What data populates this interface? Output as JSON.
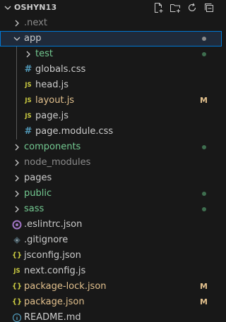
{
  "colors": {
    "background": "#181818",
    "text_default": "#cccccc",
    "text_dim": "#8b8b8b",
    "untracked": "#73c991",
    "modified": "#e2c08d",
    "accent": "#0078d4",
    "js_icon": "#cbcb41",
    "css_icon": "#519aba",
    "json_icon": "#cbcb41",
    "eslint_icon": "#a074c4",
    "info_icon": "#519aba"
  },
  "explorer": {
    "title": "OSHYN13",
    "actions": [
      {
        "name": "new-file-icon"
      },
      {
        "name": "new-folder-icon"
      },
      {
        "name": "refresh-icon"
      },
      {
        "name": "collapse-all-icon"
      }
    ]
  },
  "tree": [
    {
      "label": ".next",
      "type": "folder",
      "expanded": false,
      "depth": 0,
      "color": "dim"
    },
    {
      "label": "app",
      "type": "folder",
      "expanded": true,
      "depth": 0,
      "color": "default",
      "active": true,
      "decoration": "dot-dim"
    },
    {
      "label": "test",
      "type": "folder",
      "expanded": false,
      "depth": 1,
      "color": "untracked",
      "decoration": "dot-untracked"
    },
    {
      "label": "globals.css",
      "type": "file",
      "icon": "css",
      "depth": 1,
      "color": "default"
    },
    {
      "label": "head.js",
      "type": "file",
      "icon": "js",
      "depth": 1,
      "color": "default"
    },
    {
      "label": "layout.js",
      "type": "file",
      "icon": "js",
      "depth": 1,
      "color": "modified",
      "badge": "M"
    },
    {
      "label": "page.js",
      "type": "file",
      "icon": "js",
      "depth": 1,
      "color": "default"
    },
    {
      "label": "page.module.css",
      "type": "file",
      "icon": "css",
      "depth": 1,
      "color": "default"
    },
    {
      "label": "components",
      "type": "folder",
      "expanded": false,
      "depth": 0,
      "color": "untracked",
      "decoration": "dot-untracked"
    },
    {
      "label": "node_modules",
      "type": "folder",
      "expanded": false,
      "depth": 0,
      "color": "dim"
    },
    {
      "label": "pages",
      "type": "folder",
      "expanded": false,
      "depth": 0,
      "color": "default"
    },
    {
      "label": "public",
      "type": "folder",
      "expanded": false,
      "depth": 0,
      "color": "untracked",
      "decoration": "dot-untracked"
    },
    {
      "label": "sass",
      "type": "folder",
      "expanded": false,
      "depth": 0,
      "color": "untracked",
      "decoration": "dot-untracked"
    },
    {
      "label": ".eslintrc.json",
      "type": "file",
      "icon": "eslint",
      "depth": 0,
      "color": "default"
    },
    {
      "label": ".gitignore",
      "type": "file",
      "icon": "git",
      "depth": 0,
      "color": "default"
    },
    {
      "label": "jsconfig.json",
      "type": "file",
      "icon": "json",
      "depth": 0,
      "color": "default"
    },
    {
      "label": "next.config.js",
      "type": "file",
      "icon": "js",
      "depth": 0,
      "color": "default"
    },
    {
      "label": "package-lock.json",
      "type": "file",
      "icon": "json",
      "depth": 0,
      "color": "modified",
      "badge": "M"
    },
    {
      "label": "package.json",
      "type": "file",
      "icon": "json",
      "depth": 0,
      "color": "modified",
      "badge": "M"
    },
    {
      "label": "README.md",
      "type": "file",
      "icon": "info",
      "depth": 0,
      "color": "default"
    }
  ]
}
